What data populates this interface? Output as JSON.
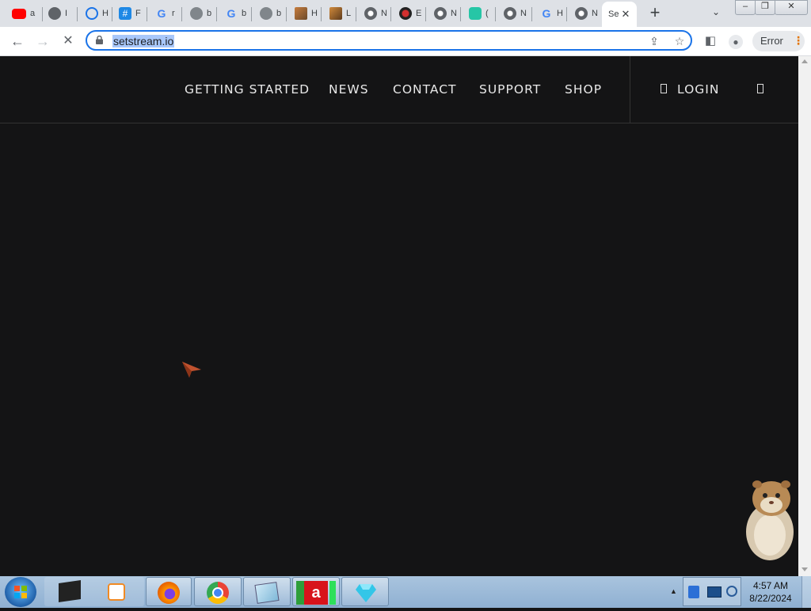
{
  "browser": {
    "tabs": [
      {
        "title": "a",
        "icon": "youtube-icon"
      },
      {
        "title": "I",
        "icon": "globe-icon"
      },
      {
        "title": "H",
        "icon": "history-icon"
      },
      {
        "title": "F",
        "icon": "hashtag-icon"
      },
      {
        "title": "r",
        "icon": "google-icon"
      },
      {
        "title": "b",
        "icon": "globe-icon"
      },
      {
        "title": "b",
        "icon": "google-icon"
      },
      {
        "title": "b",
        "icon": "globe-icon"
      },
      {
        "title": "H",
        "icon": "image-icon"
      },
      {
        "title": "L",
        "icon": "image-icon"
      },
      {
        "title": "N",
        "icon": "chrome-icon"
      },
      {
        "title": "E",
        "icon": "record-icon"
      },
      {
        "title": "N",
        "icon": "chrome-icon"
      },
      {
        "title": "(",
        "icon": "app-icon"
      },
      {
        "title": "N",
        "icon": "chrome-icon"
      },
      {
        "title": "H",
        "icon": "google-icon"
      },
      {
        "title": "N",
        "icon": "chrome-icon"
      },
      {
        "title": "Se",
        "icon": "blank-icon",
        "active": true
      }
    ],
    "url": "setstream.io",
    "error_label": "Error"
  },
  "site": {
    "nav": [
      "GETTING STARTED",
      "NEWS",
      "CONTACT",
      "SUPPORT",
      "SHOP"
    ],
    "login_label": "LOGIN"
  },
  "taskbar": {
    "time": "4:57 AM",
    "date": "8/22/2024"
  },
  "colors": {
    "page_background": "#141415",
    "nav_text": "#e8e8e8",
    "omnibox_focus": "#1a73e8",
    "url_selection": "#a8c7fa",
    "error_accent": "#e37400"
  }
}
